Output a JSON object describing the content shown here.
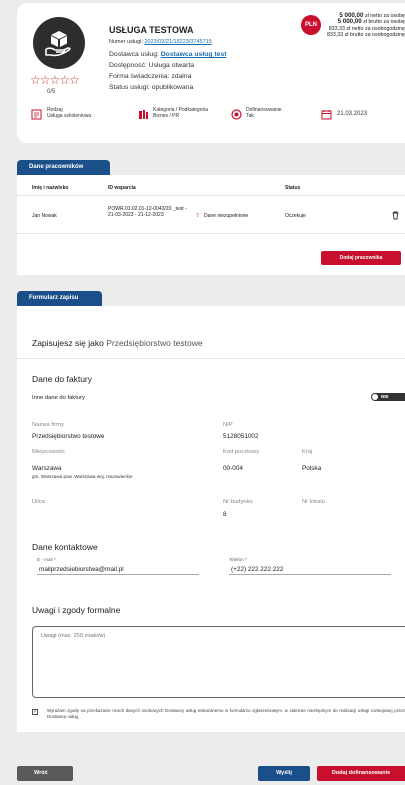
{
  "service": {
    "title": "USŁUGA TESTOWA",
    "number_label": "Numer usługi:",
    "number_value": "2023/03/21/18223/3745715",
    "provider_label": "Dostawca usług:",
    "provider_value": "Dostawca usług test",
    "availability": "Dostępność: Usługa otwarta",
    "form": "Forma świadczenia: zdalna",
    "status": "Status usługi: opublikowana",
    "rating": "0/5",
    "currency": "PLN",
    "price_netto": "5 000,00",
    "price_netto_label": "zł netto za osobę",
    "price_brutto": "5 000,00",
    "price_brutto_label": "zł brutto za osobę",
    "price_netto_hour": "833,33 zł netto za osobogodzinę",
    "price_brutto_hour": "833,33 zł brutto za osobogodzinę",
    "meta": [
      {
        "label": "Rodzaj",
        "value": "Usługa szkoleniowa"
      },
      {
        "label": "Kategoria / Podkategoria",
        "value": "Biznes / PR"
      },
      {
        "label": "Dofinansowanie",
        "value": "Tak"
      },
      {
        "label": "",
        "value": "21.03.2023"
      }
    ]
  },
  "employees": {
    "tab": "Dane pracowników",
    "headers": {
      "name": "Imię i nazwisko",
      "id": "ID wsparcia",
      "status": "Status"
    },
    "rows": [
      {
        "name": "Jan Nowak",
        "id": "POWR.01.02.01-12-0043/20 _test - 21-03-2023 - 21-12-2023",
        "data": "Dane niezupełnione",
        "status": "Oczekuje"
      }
    ],
    "add_button": "Dodaj pracownika"
  },
  "form": {
    "tab": "Formularz zapisu",
    "enroll_prefix": "Zapisujesz się jako",
    "enroll_value": "Przedsiębiorstwo testowe",
    "invoice_title": "Dane do faktury",
    "other_invoice_label": "Inne dane do faktury",
    "toggle_label": "NIE",
    "company_label": "Nazwa firmy",
    "company_value": "Przedsiębiorstwo testowe",
    "nip_label": "NIP",
    "nip_value": "5128051002",
    "city_label": "Miejscowość",
    "city_value": "Warszawa",
    "city_detail": "gm. Warszawa pow. Warszawa woj. mazowieckie",
    "postal_label": "Kod pocztowy",
    "postal_value": "00-004",
    "country_label": "Kraj",
    "country_value": "Polska",
    "street_label": "Ulica",
    "street_value": "",
    "building_label": "Nr budynku",
    "building_value": "8",
    "apt_label": "Nr lokalu",
    "apt_value": "",
    "contact_title": "Dane kontaktowe",
    "email_label": "E - mail",
    "email_value": "mailprzedsiebiorstwa@mail.pl",
    "phone_label": "Telefon",
    "phone_value": "(+22) 222 222 222",
    "remarks_title": "Uwagi i zgody formalne",
    "remarks_placeholder": "Uwagi (max. 250 znaków)",
    "consent_text": "Wyrażam zgodę na przekazanie moich danych osobowych Dostawcy usług wskazanemu w formularzu zgłoszeniowym, w zakresie niezbędnym do realizacji usługi rozwojowej przez Dostawcę usług."
  },
  "buttons": {
    "back": "Wróć",
    "send": "Wyślij",
    "add_funding": "Dodaj dofinansowanie"
  },
  "colors": {
    "accent": "#c8102e",
    "tab": "#1b4f8a",
    "link": "#1a6db5"
  }
}
